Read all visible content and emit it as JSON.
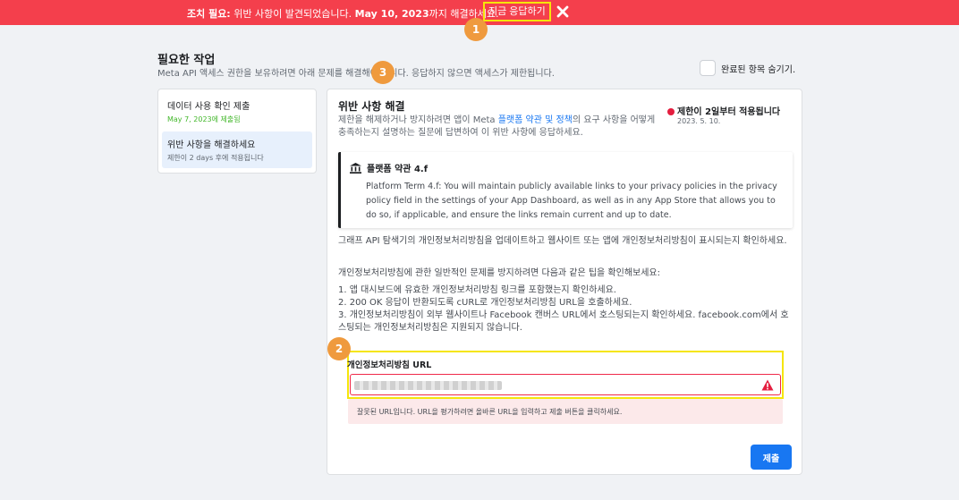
{
  "banner": {
    "prefix": "조치 필요:",
    "message": " 위반 사항이 발견되었습니다. ",
    "date": "May 10, 2023",
    "suffix": "까지 해결하세요.",
    "respond_label": "지금 응답하기",
    "color": "#f43f4c"
  },
  "badges": [
    "1",
    "2",
    "3"
  ],
  "page": {
    "title": "필요한 작업",
    "subtitle": "Meta API 액세스 권한을 보유하려면 아래 문제를 해결해야 합니다. 응답하지 않으면 액세스가 제한됩니다.",
    "hide_completed": "완료된 항목 숨기기."
  },
  "tasks": [
    {
      "title": "데이터 사용 확인 제출",
      "status": "May 7, 2023에 제출됨"
    },
    {
      "title": "위반 사항을 해결하세요",
      "status": "제한이 2 days 후에 적용됩니다"
    }
  ],
  "card": {
    "title": "위반 사항 해결",
    "desc_before": "제한을 해제하거나 방지하려면 앱이 Meta ",
    "desc_link": "플랫폼 약관 및 정책",
    "desc_after": "의 요구 사항을 어떻게 충족하는지 설명하는 질문에 답변하여 이 위반 사항에 응답하세요.",
    "status_title": "제한이 2일부터 적용됩니다",
    "status_date": "2023. 5. 10."
  },
  "term": {
    "heading": "플랫폼 약관 4.f",
    "body": "Platform Term 4.f: You will maintain publicly available links to your privacy policies in the privacy policy field in the settings of your App Dashboard, as well as in any App Store that allows you to do so, if applicable, and ensure the links remain current and up to date."
  },
  "instructions": {
    "p1": "그래프 API 탐색기의 개인정보처리방침을 업데이트하고 웹사이트 또는 앱에 개인정보처리방침이 표시되는지 확인하세요.",
    "p2": "개인정보처리방침에 관한 일반적인 문제를 방지하려면 다음과 같은 팁을 확인해보세요:",
    "tips": [
      "1. 앱 대시보드에 유효한 개인정보처리방침 링크를 포함했는지 확인하세요.",
      "2. 200 OK 응답이 반환되도록 cURL로 개인정보처리방침 URL을 호출하세요.",
      "3. 개인정보처리방침이 외부 웹사이트나 Facebook 캔버스 URL에서 호스팅되는지 확인하세요. facebook.com에서 호스팅되는 개인정보처리방침은 지원되지 않습니다."
    ]
  },
  "url_field": {
    "label": "개인정보처리방침 URL",
    "error": "잘못된 URL입니다. URL을 평가하려면 올바른 URL을 입력하고 제출 버튼을 클릭하세요."
  },
  "submit_label": "제출",
  "colors": {
    "accent": "#1877f2",
    "error": "#f02849",
    "highlight": "#f5e50b",
    "badge": "#ef9a3e"
  },
  "icons": [
    "close-icon",
    "bank-icon",
    "warning-icon"
  ]
}
